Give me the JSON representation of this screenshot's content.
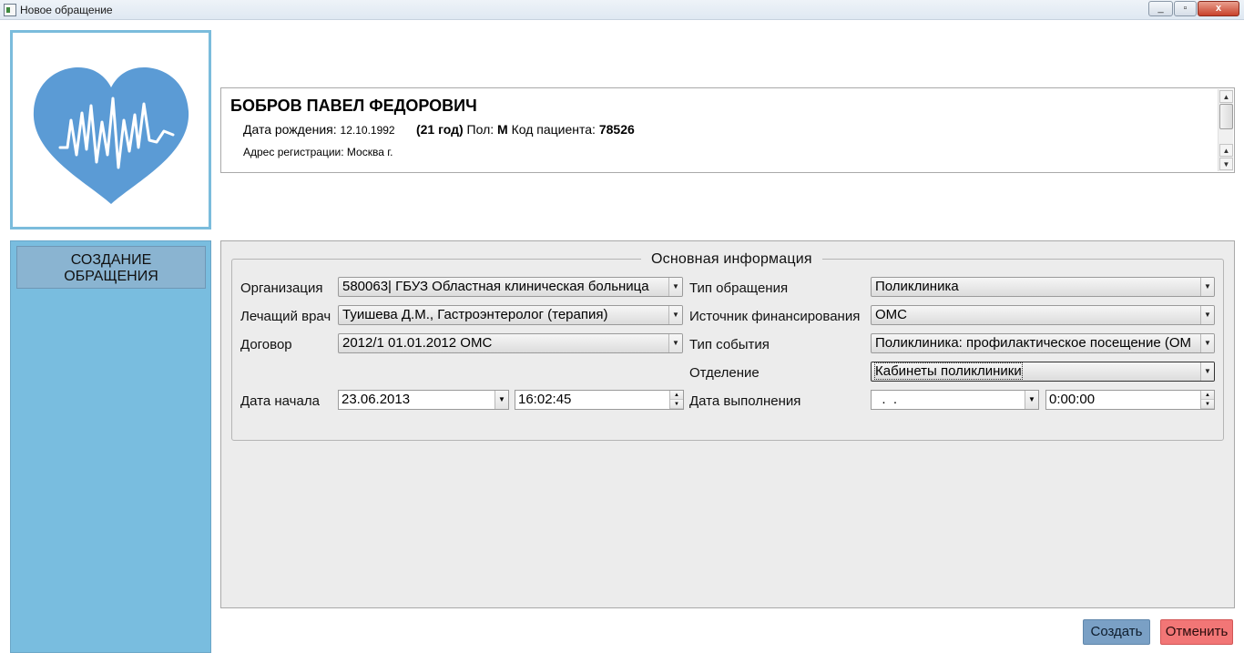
{
  "window": {
    "title": "Новое обращение",
    "controls": {
      "minimize": "_",
      "maximize": "▫",
      "close": "x"
    }
  },
  "logo": {
    "icon": "heart-pulse-icon",
    "color": "#5b9bd5"
  },
  "patient": {
    "name": "БОБРОВ ПАВЕЛ ФЕДОРОВИЧ",
    "dob_label": "Дата рождения:",
    "dob": "12.10.1992",
    "age": "(21 год)",
    "sex_label": "Пол:",
    "sex": "М",
    "code_label": "Код пациента:",
    "code": "78526",
    "address_label": "Адрес регистрации:",
    "address": "Москва г."
  },
  "nav": {
    "create_line1": "СОЗДАНИЕ",
    "create_line2": "ОБРАЩЕНИЯ"
  },
  "form": {
    "legend": "Основная информация",
    "org_label": "Организация",
    "org_value": "580063| ГБУЗ Областная клиническая больница",
    "doctor_label": "Лечащий врач",
    "doctor_value": "Туишева Д.М., Гастроэнтеролог (терапия)",
    "contract_label": "Договор",
    "contract_value": "2012/1 01.01.2012 ОМС",
    "start_label": "Дата начала",
    "start_date": "23.06.2013",
    "start_time": "16:02:45",
    "type_label": "Тип обращения",
    "type_value": "Поликлиника",
    "funding_label": "Источник финансирования",
    "funding_value": "ОМС",
    "event_label": "Тип события",
    "event_value": "Поликлиника: профилактическое посещение (ОМ",
    "dept_label": "Отделение",
    "dept_value": "Кабинеты поликлиники",
    "done_label": "Дата выполнения",
    "done_date": "  .  .",
    "done_time": "0:00:00"
  },
  "buttons": {
    "create": "Создать",
    "cancel": "Отменить"
  },
  "colors": {
    "nav_bg": "#79bddf",
    "create_btn": "#7aa0c5",
    "cancel_btn": "#f27676"
  }
}
